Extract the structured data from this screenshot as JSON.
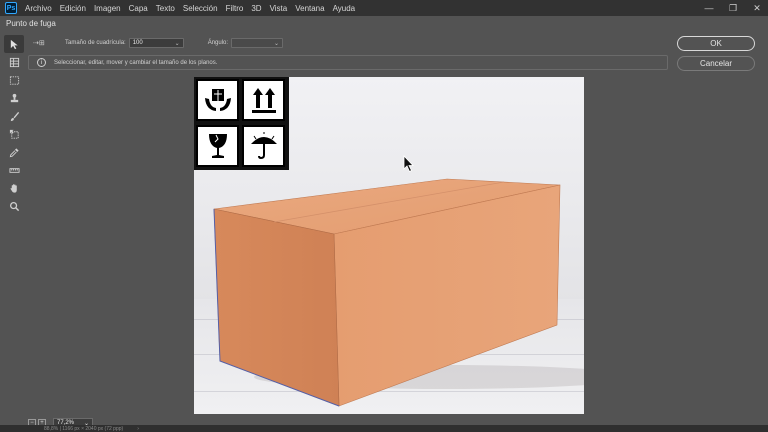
{
  "app": {
    "logo": "Ps"
  },
  "menu": [
    "Archivo",
    "Edición",
    "Imagen",
    "Capa",
    "Texto",
    "Selección",
    "Filtro",
    "3D",
    "Vista",
    "Ventana",
    "Ayuda"
  ],
  "window_controls": {
    "minimize": "—",
    "restore": "❐",
    "close": "✕"
  },
  "dialog": {
    "title": "Punto de fuga",
    "options": {
      "grid_size_label": "Tamaño de cuadrícula:",
      "grid_size_value": "100",
      "angle_label": "Ángulo:",
      "angle_value": ""
    },
    "info_text": "Seleccionar, editar, mover y cambiar el tamaño de los planos.",
    "ok_label": "OK",
    "cancel_label": "Cancelar",
    "zoom_value": "77,2%",
    "status_strip_left": "88,8%  |  1166 px × 2040 px (72 ppp)",
    "tools": [
      "edit-plane",
      "create-plane",
      "marquee",
      "stamp",
      "brush",
      "transform",
      "eyedropper",
      "measure",
      "hand",
      "zoom"
    ],
    "canvas_symbols": [
      "fragile-handle-with-care-icon",
      "this-way-up-arrows-icon",
      "fragile-glass-icon",
      "keep-dry-umbrella-icon"
    ]
  },
  "colors": {
    "box": "#d98a5c",
    "accent_blue": "#31a8ff"
  }
}
